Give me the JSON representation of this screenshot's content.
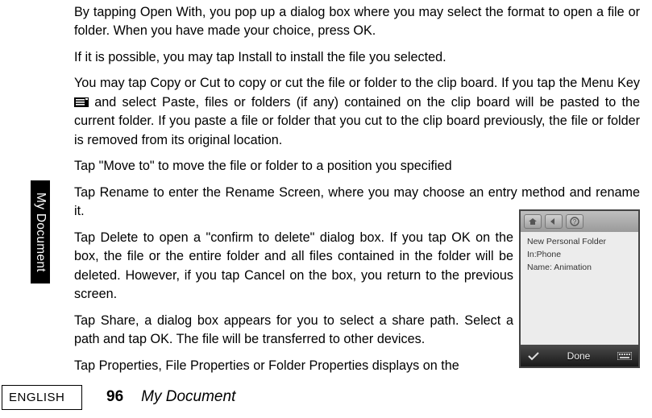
{
  "sidebar": {
    "label": "My Document"
  },
  "paragraphs": {
    "p1": "By tapping Open With, you pop up a dialog box where you may select the format to open a file or folder. When you have made your choice, press OK.",
    "p2": "If it is possible, you may tap Install to install the file you selected.",
    "p3a": "You may tap Copy or Cut to copy or cut the file or folder to the clip board. If you tap the Menu Key ",
    "p3b": " and select Paste, files or folders (if any) contained on the clip board will be pasted to the current folder. If you paste a file or folder that you cut to the clip board previously, the file or folder is removed from its original location.",
    "p4": "Tap \"Move to\" to move the file or folder to a position you specified",
    "p5": "Tap Rename to enter the Rename Screen, where you may choose an entry method and rename it.",
    "p6": "Tap Delete to open a \"confirm to delete\" dialog box. If you tap OK on the box, the file or the entire folder and all files contained in the folder will be deleted. However, if you tap Cancel on the box, you return to the previous screen.",
    "p7": "Tap Share, a dialog box appears for you to select a share path. Select a path and tap OK. The file will be transferred to other devices.",
    "p8": "Tap Properties, File Properties or Folder Properties displays on the"
  },
  "inset": {
    "line1": "New Personal Folder",
    "line2": "In:Phone",
    "line3": "Name: Animation",
    "done": "Done"
  },
  "footer": {
    "english": "ENGLISH",
    "page": "96",
    "title": "My Document"
  }
}
